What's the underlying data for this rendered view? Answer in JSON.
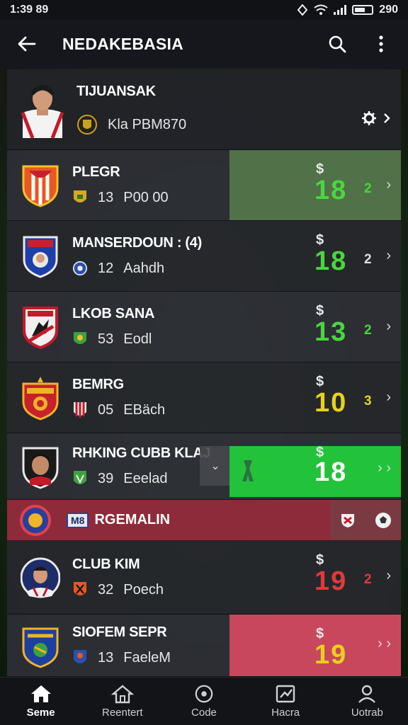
{
  "status": {
    "time": "1:39 89",
    "battery": "290"
  },
  "app_bar": {
    "title": "NEDAKEBASIA"
  },
  "profile": {
    "name": "TIJUANSAK",
    "detail": "Kla PBM870"
  },
  "clubs": [
    {
      "name": "PLEGR",
      "num": "13",
      "tail": "P00 00",
      "big": "18",
      "small": "2",
      "big_color": "green"
    },
    {
      "name": "MANSERDOUN : (4)",
      "num": "12",
      "tail": "Aahdh",
      "big": "18",
      "small": "2",
      "big_color": "green"
    },
    {
      "name": "LKOB SANA",
      "num": "53",
      "tail": "Eodl",
      "big": "13",
      "small": "2",
      "big_color": "green"
    },
    {
      "name": "BEMRG",
      "num": "05",
      "tail": "EBäch",
      "big": "10",
      "small": "3",
      "big_color": "yellow"
    },
    {
      "name": "RHKING CUBB KLAJ",
      "num": "39",
      "tail": "Eeelad",
      "big": "18",
      "small": "",
      "big_color": "white"
    }
  ],
  "banner": {
    "tag": "M8",
    "label": "RGEMALIN"
  },
  "clubs2": [
    {
      "name": "CLUB KIM",
      "num": "32",
      "tail": "Poech",
      "big": "19",
      "small": "2",
      "big_color": "red"
    },
    {
      "name": "SIOFEM SEPR",
      "num": "13",
      "tail": "FaeleM",
      "big": "19",
      "small": "",
      "big_color": "yellow"
    }
  ],
  "currency_symbol": "$",
  "nav": [
    {
      "label": "Seme",
      "icon": "home-icon"
    },
    {
      "label": "Reentert",
      "icon": "house-outline-icon"
    },
    {
      "label": "Code",
      "icon": "target-icon"
    },
    {
      "label": "Hacra",
      "icon": "chart-icon"
    },
    {
      "label": "Uotrab",
      "icon": "person-icon"
    }
  ],
  "colors": {
    "green": "#49d63f",
    "yellow": "#e7d21b",
    "red": "#e03a3a",
    "banner": "#8e2b3a"
  }
}
